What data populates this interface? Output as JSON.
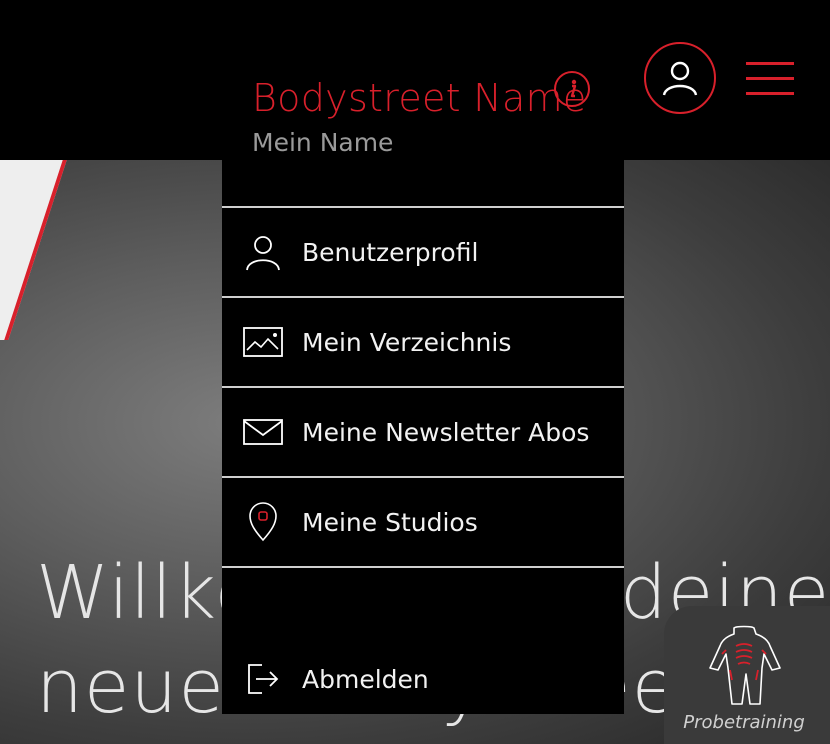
{
  "header": {
    "studio_name": "Bodystreet Name",
    "user_name": "Mein Name"
  },
  "menu": {
    "items": [
      {
        "label": "Benutzerprofil",
        "icon": "user-icon"
      },
      {
        "label": "Mein Verzeichnis",
        "icon": "image-icon"
      },
      {
        "label": "Meine Newsletter Abos",
        "icon": "envelope-icon"
      },
      {
        "label": "Meine Studios",
        "icon": "location-pin-icon"
      }
    ],
    "logout_label": "Abmelden"
  },
  "hero": {
    "line1": "Willkommen in deiner",
    "line2": "neuen Bodystreet"
  },
  "probetraining": {
    "label": "Probetraining"
  },
  "colors": {
    "accent": "#d8202b",
    "background": "#000000",
    "panel": "#3a3a3a"
  }
}
